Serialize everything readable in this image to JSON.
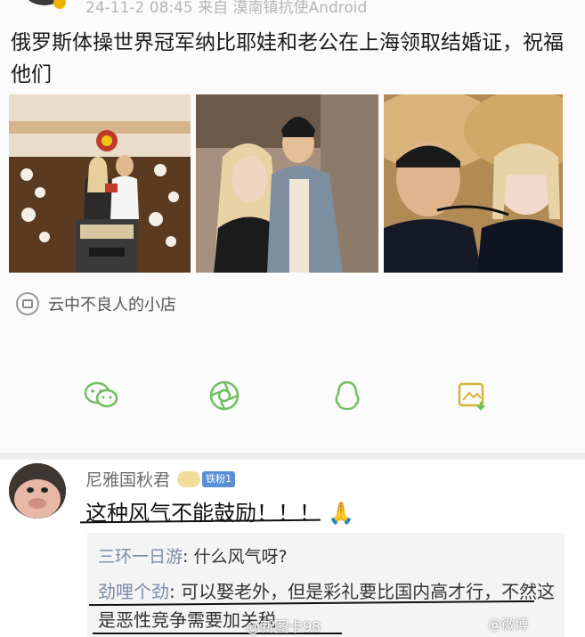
{
  "post": {
    "meta": "24-11-2 08:45 来自 漠南镇抗使Android",
    "text": "俄罗斯体操世界冠军纳比耶娃和老公在上海领取结婚证，祝福他们",
    "shop_label": "云中不良人的小店",
    "share_icons": [
      "wechat-icon",
      "moments-icon",
      "qq-icon",
      "save-image-icon"
    ],
    "colors": {
      "accent_green": "#6fbf60",
      "wechat_green": "#5cb85c"
    }
  },
  "comment": {
    "author": "尼雅国秋君",
    "level": "铁粉1",
    "text": "这种风气不能鼓励！！！",
    "pray": "🙏",
    "replies": [
      {
        "name": "三环一日游",
        "sep": ": ",
        "text": "什么风气呀?"
      },
      {
        "name": "劲哩个劲",
        "sep": ": ",
        "text": "可以娶老外，但是彩礼要比国内高才行，不然这是恶性竞争需要加关税"
      }
    ]
  },
  "watermark": "@新图卡98",
  "watermark2": "@微博"
}
